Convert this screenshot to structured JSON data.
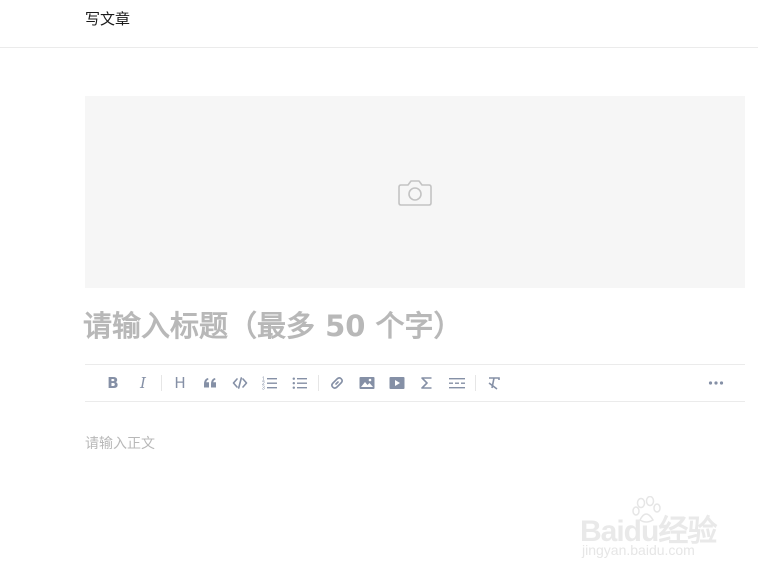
{
  "header": {
    "title": "写文章"
  },
  "cover": {
    "icon": "camera-icon"
  },
  "title_input": {
    "placeholder": "请输入标题（最多 50 个字）",
    "value": ""
  },
  "toolbar": {
    "bold_label": "B",
    "italic_label": "I",
    "heading_label": "H",
    "items": [
      "bold-icon",
      "italic-icon",
      "heading-icon",
      "quote-icon",
      "code-icon",
      "ordered-list-icon",
      "unordered-list-icon",
      "link-icon",
      "image-icon",
      "video-icon",
      "formula-icon",
      "divider-icon",
      "clear-format-icon",
      "more-icon"
    ]
  },
  "body_input": {
    "placeholder": "请输入正文",
    "value": ""
  },
  "watermark": {
    "main": "Baidu经验",
    "sub": "jingyan.baidu.com"
  },
  "colors": {
    "icon": "#8590a6",
    "placeholder": "#b8b8b8",
    "cover_bg": "#f6f6f6",
    "border": "#ebebeb"
  }
}
